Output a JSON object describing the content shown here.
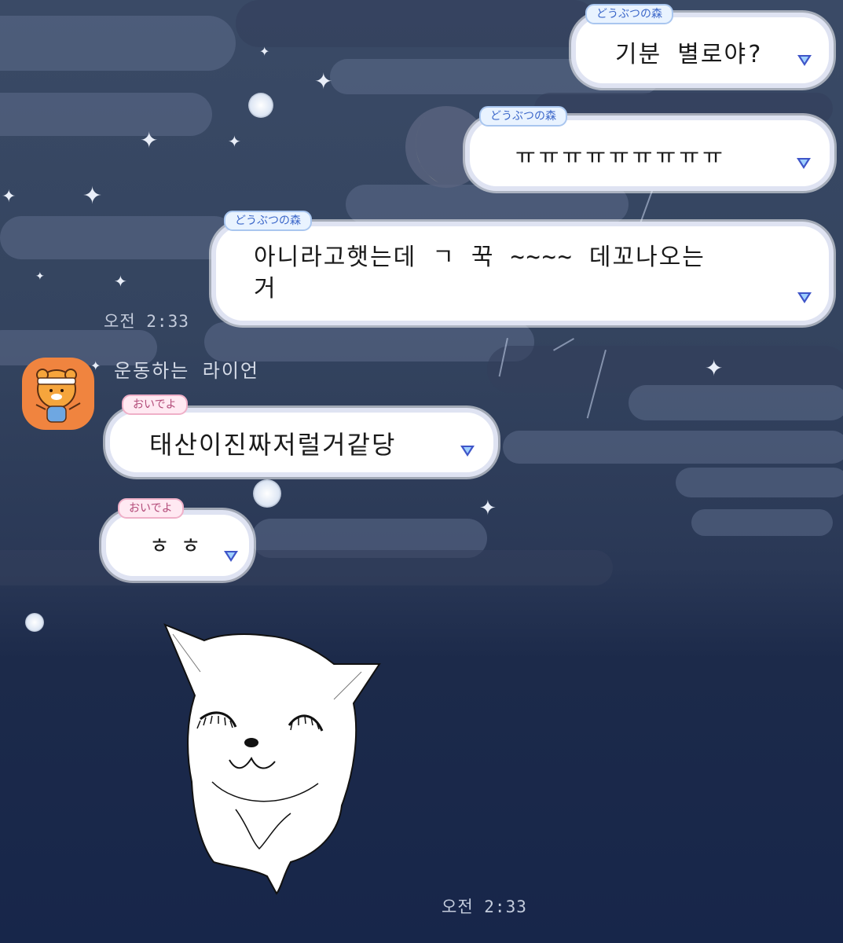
{
  "theme": {
    "sent_tag_color": "#3a66c9",
    "received_tag_color": "#b24a78",
    "bubble_color": "#ffffff",
    "avatar_color": "#f0843f"
  },
  "messages": [
    {
      "tag": "どうぶつの森",
      "text": "기분 별로야?"
    },
    {
      "tag": "どうぶつの森",
      "text": "ㅠㅠㅠㅠㅠㅠㅠㅠㅠ"
    },
    {
      "tag": "どうぶつの森",
      "text": "아니라고햇는데 ㄱ 꾹 ~~~~ 데꼬나오는\n거"
    },
    {
      "tag": "おいでよ",
      "text": "태산이진짜저럴거같당"
    },
    {
      "tag": "おいでよ",
      "text": "ㅎㅎ"
    }
  ],
  "sent_time": "오전 2:33",
  "friend": {
    "name": "운동하는 라이언",
    "avatar_icon": "ryan-avatar-icon"
  },
  "sticker": {
    "icon": "white-dog-sticker-icon"
  },
  "received_time": "오전 2:33"
}
